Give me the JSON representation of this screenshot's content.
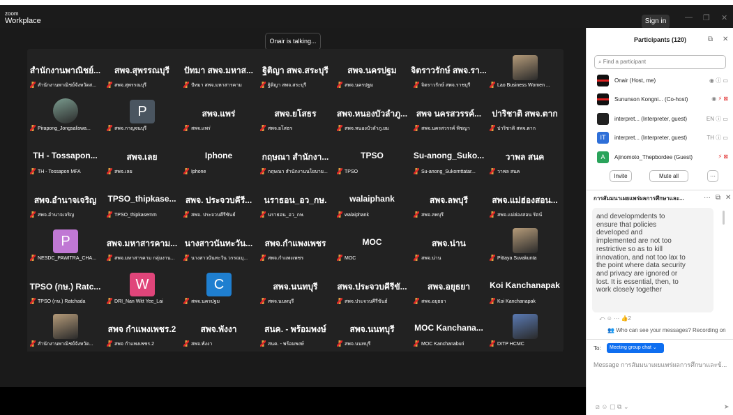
{
  "titlebar": {
    "brand_line1": "zoom",
    "brand_line2": "Workplace",
    "signin_label": "Sign in"
  },
  "talking_indicator": "Onair is talking...",
  "tiles": [
    {
      "big": "สำนักงานพาณิชย์...",
      "small": "สำนักงานพาณิชย์จังหวัดส..."
    },
    {
      "big": "สพจ.สุพรรณบุรี",
      "small": "สพจ.สุพรรณบุรี"
    },
    {
      "big": "ปัทมา สพจ.มหาส...",
      "small": "ปัทมา สพจ.มหาสารคาม"
    },
    {
      "big": "ฐิติญา สพจ.สระบุรี",
      "small": "ฐิติญา สพจ.สระบุรี"
    },
    {
      "big": "สพจ.นครปฐม",
      "small": "สพจ.นครปฐม"
    },
    {
      "big": "จิตราวรักษ์ สพจ.รา...",
      "small": "จิตราวรักษ์ สพจ.ราชบุรี"
    },
    {
      "big": "",
      "small": "Lao Business Women ..."
    },
    {
      "big": "",
      "small": "Pirapong_Jongsaliswa..."
    },
    {
      "big": "",
      "small": "สพจ.กาญจนบุรี",
      "avatar": "P"
    },
    {
      "big": "สพจ.แพร่",
      "small": "สพจ.แพร่"
    },
    {
      "big": "สพจ.ยโสธร",
      "small": "สพจ.ยโสธร"
    },
    {
      "big": "สพจ.หนองบัวลำภู...",
      "small": "สพจ.หนองบัวลำภู.ยม"
    },
    {
      "big": "สพจ นครสวรรค์...",
      "small": "สพจ.นครสวรรค์ พิชญา"
    },
    {
      "big": "ปาริชาติ สพจ.ตาก",
      "small": "ปาริชาติ สพจ.ตาก"
    },
    {
      "big": "TH - Tossapon...",
      "small": "TH - Tossapon MFA"
    },
    {
      "big": "สพจ.เลย",
      "small": "สพจ.เลย"
    },
    {
      "big": "Iphone",
      "small": "Iphone"
    },
    {
      "big": "กฤษณา สำนักงา...",
      "small": "กฤษณา สำนักงานนโยบาย..."
    },
    {
      "big": "TPSO",
      "small": "TPSO"
    },
    {
      "big": "Su-anong_Suko...",
      "small": "Su-anong_Sukornttatar..."
    },
    {
      "big": "วาพล สนค",
      "small": "วาพล สนค"
    },
    {
      "big": "สพจ.อำนาจเจริญ",
      "small": "สพจ.อำนาจเจริญ"
    },
    {
      "big": "TPSO_thipkase...",
      "small": "TPSO_thipkasemm"
    },
    {
      "big": "สพจ. ประจวบคีรี...",
      "small": "สพจ. ประจวบคีรีขันธ์"
    },
    {
      "big": "นราธอน_อว_กษ.",
      "small": "นราธอน_อว_กษ."
    },
    {
      "big": "walaiphank",
      "small": "walaiphank"
    },
    {
      "big": "สพจ.ลพบุรี",
      "small": "สพจ.ลพบุรี"
    },
    {
      "big": "สพจ.แม่ฮ่องสอน...",
      "small": "สพจ.แม่ฮ่องสอน รัตน์"
    },
    {
      "big": "",
      "small": "NESDC_PAWITRA_CHA...",
      "avatar": "P"
    },
    {
      "big": "สพจ.มหาสารคาม...",
      "small": "สพจ.มหาสารคาม กลุ่มงาน..."
    },
    {
      "big": "นางสาวนันทะวัน...",
      "small": "นางสาวนันทะวัน วรรณบุ..."
    },
    {
      "big": "สพจ.กำแพงเพชร",
      "small": "สพจ.กำแพงเพชร"
    },
    {
      "big": "MOC",
      "small": "MOC"
    },
    {
      "big": "สพจ.น่าน",
      "small": "สพจ.น่าน"
    },
    {
      "big": "",
      "small": "Pittaya Suvakunta"
    },
    {
      "big": "TPSO (กษ.) Ratc...",
      "small": "TPSO (กษ.) Ratchada"
    },
    {
      "big": "",
      "small": "DRI_Nan Witt Yee_Lai",
      "avatar": "W"
    },
    {
      "big": "",
      "small": "สพจ.นครปฐม",
      "avatar": "C"
    },
    {
      "big": "สพจ.นนทบุรี",
      "small": "สพจ.นนทบุรี"
    },
    {
      "big": "สพจ.ประจวบคีรีขั...",
      "small": "สพจ.ประจวบคีรีขันธ์"
    },
    {
      "big": "สพจ.อยุธยา",
      "small": "สพจ.อยุธยา"
    },
    {
      "big": "Koi Kanchanapak",
      "small": "Koi Kanchanapak"
    },
    {
      "big": "",
      "small": "สำนักงานพาณิชย์จังหวัด..."
    },
    {
      "big": "สพจ กำแพงเพชร.2",
      "small": "สพจ กำแพงเพชร.2"
    },
    {
      "big": "สพจ.พังงา",
      "small": "สพจ.พังงา"
    },
    {
      "big": "สนค. - พร้อมพงษ์",
      "small": "สนค. - พร้อมพงษ์"
    },
    {
      "big": "สพจ.นนทบุรี",
      "small": "สพจ.นนทบุรี"
    },
    {
      "big": "MOC Kanchana...",
      "small": "MOC Kanchanaburi"
    },
    {
      "big": "",
      "small": "DITP HCMC"
    }
  ],
  "participants": {
    "title": "Participants (120)",
    "search_placeholder": "Find a participant",
    "rows": [
      {
        "name": "Onair (Host, me)",
        "icons": "⦿  🎙  ▭"
      },
      {
        "name": "Sununson Kongni... (Co-host)",
        "icons": "⦿  ✗  ✗"
      },
      {
        "name": "interpret... (Interpreter, guest)",
        "badge": "EN",
        "icons": "🎙  ▭"
      },
      {
        "name": "interpret... (Interpreter, guest)",
        "badge": "TH",
        "icons": "🎙  ▭",
        "avatar": "IT"
      },
      {
        "name": "Ajinomoto_Thepbordee (Guest)",
        "icons": "✗  ✗",
        "avatar": "A"
      }
    ],
    "invite_label": "Invite",
    "mute_all_label": "Mute all",
    "more_label": "···"
  },
  "chat": {
    "title": "การสัมมนาเผยแพร่ผลการศึกษาและ...",
    "lines": [
      "and developmdents to",
      "ensure that policies",
      "deveIoped and",
      "implemented are not too",
      "restrictive so as to kill",
      "innovation, and not too lax to",
      "the point where data security",
      "and privacy are ignored or",
      "lost.  It is essential, then, to",
      "work closely together"
    ],
    "reaction_count": "2",
    "who_can_see": "Who can see your messages? Recording on",
    "to_label": "To:",
    "recipient": "Meeting group chat",
    "message_placeholder": "Message การสัมมนาเผยแพร่ผลการศึกษาและข้..."
  }
}
